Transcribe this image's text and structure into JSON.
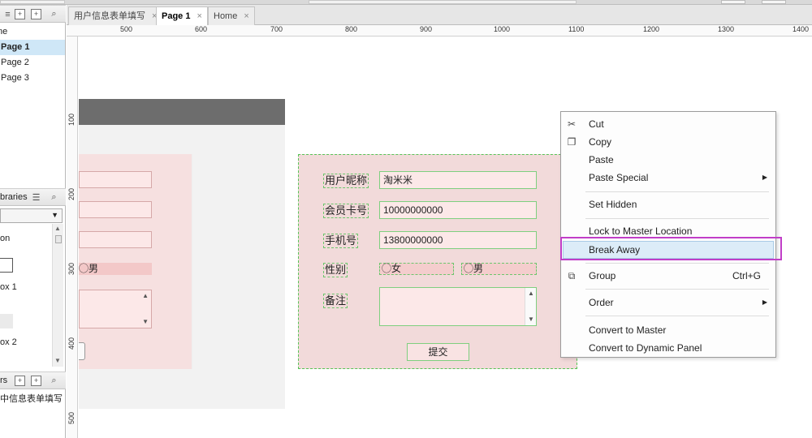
{
  "pages_panel": {
    "items": [
      {
        "label": "ne",
        "selected": false
      },
      {
        "label": "Page 1",
        "selected": true
      },
      {
        "label": "Page 2",
        "selected": false
      },
      {
        "label": "Page 3",
        "selected": false
      }
    ]
  },
  "libraries_panel": {
    "title": "braries",
    "items": [
      "on",
      "ox 1",
      "ox 2"
    ]
  },
  "masters_panel": {
    "title": "rs",
    "item": "中信息表单填写"
  },
  "tabs": [
    {
      "label": "用户信息表单填写",
      "active": false
    },
    {
      "label": "Page 1",
      "active": true
    },
    {
      "label": "Home",
      "active": false
    }
  ],
  "ruler_h": [
    "500",
    "600",
    "700",
    "800",
    "900",
    "1000",
    "1100",
    "1200",
    "1300",
    "1400"
  ],
  "ruler_v": [
    "100",
    "200",
    "300",
    "400",
    "500"
  ],
  "left_form": {
    "radio_text": "◯男"
  },
  "form": {
    "nickname_label": "用户昵称",
    "nickname_value": "淘米米",
    "card_label": "会员卡号",
    "card_value": "10000000000",
    "phone_label": "手机号",
    "phone_value": "13800000000",
    "gender_label": "性别",
    "female_option": "◯女",
    "male_option": "◯男",
    "remark_label": "备注",
    "submit_label": "提交"
  },
  "context_menu": {
    "items": {
      "cut": "Cut",
      "copy": "Copy",
      "paste": "Paste",
      "paste_special": "Paste Special",
      "set_hidden": "Set Hidden",
      "lock_master": "Lock to Master Location",
      "break_away": "Break Away",
      "group": "Group",
      "group_shortcut": "Ctrl+G",
      "order": "Order",
      "convert_master": "Convert to Master",
      "convert_dynamic": "Convert to Dynamic Panel"
    },
    "highlight_color": "#c13ec8"
  }
}
